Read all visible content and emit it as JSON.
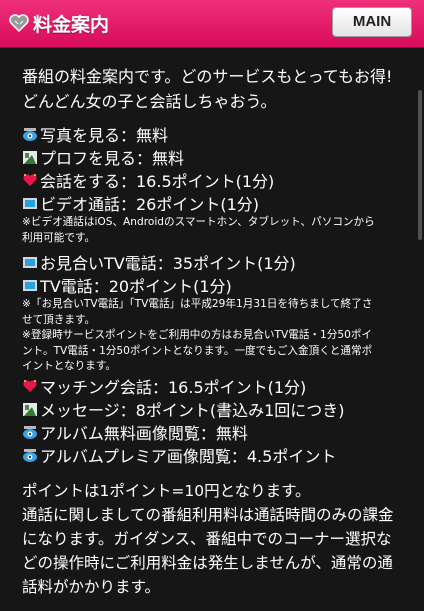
{
  "header": {
    "title": "料金案内",
    "main_button": "MAIN"
  },
  "intro": {
    "line1": "番組の料金案内です。どのサービスもとってもお得!",
    "line2": "どんどん女の子と会話しちゃおう。"
  },
  "items": [
    {
      "icon": "camera-eye-icon",
      "text": "写真を見る：無料"
    },
    {
      "icon": "profile-card-icon",
      "text": "プロフを見る：無料"
    },
    {
      "icon": "heart-sparkle-icon",
      "text": "会話をする：16.5ポイント(1分)"
    },
    {
      "icon": "video-screen-icon",
      "text": "ビデオ通話：26ポイント(1分)"
    }
  ],
  "note1": {
    "line1": "※ビデオ通話はiOS、Androidのスマートホン、タブレット、パソコンから",
    "line2": "利用可能です。"
  },
  "items2": [
    {
      "icon": "tv-screen-icon",
      "text": "お見合いTV電話：35ポイント(1分)"
    },
    {
      "icon": "tv-screen-icon",
      "text": "TV電話：20ポイント(1分)"
    }
  ],
  "note2": {
    "line1": "※「お見合いTV電話」「TV電話」は平成29年1月31日を待ちまして終了さ",
    "line2": "せて頂きます。",
    "line3": "※登録時サービスポイントをご利用中の方はお見合いTV電話・1分50ポイ",
    "line4": "ント。TV電話・1分50ポイントとなります。一度でもご入金頂くと通常ポ",
    "line5": "イントとなります。"
  },
  "items3": [
    {
      "icon": "heart-sparkle-icon",
      "text": "マッチング会話：16.5ポイント(1分)"
    },
    {
      "icon": "message-card-icon",
      "text": "メッセージ：8ポイント(書込み1回につき)"
    },
    {
      "icon": "camera-eye-icon",
      "text": "アルバム無料画像閲覧：無料"
    },
    {
      "icon": "camera-eye-icon",
      "text": "アルバムプレミア画像閲覧：4.5ポイント"
    }
  ],
  "footer": {
    "line1": "ポイントは1ポイント=10円となります。",
    "line2": "通話に関しましての番組利用料は通話時間のみの課金",
    "line3": "になります。ガイダンス、番組中でのコーナー選択な",
    "line4": "どの操作時にご利用料金は発生しませんが、通常の通",
    "line5": "話料がかかります。"
  },
  "colors": {
    "header": "#e31c68",
    "background": "#161616",
    "text": "#ffffff"
  }
}
